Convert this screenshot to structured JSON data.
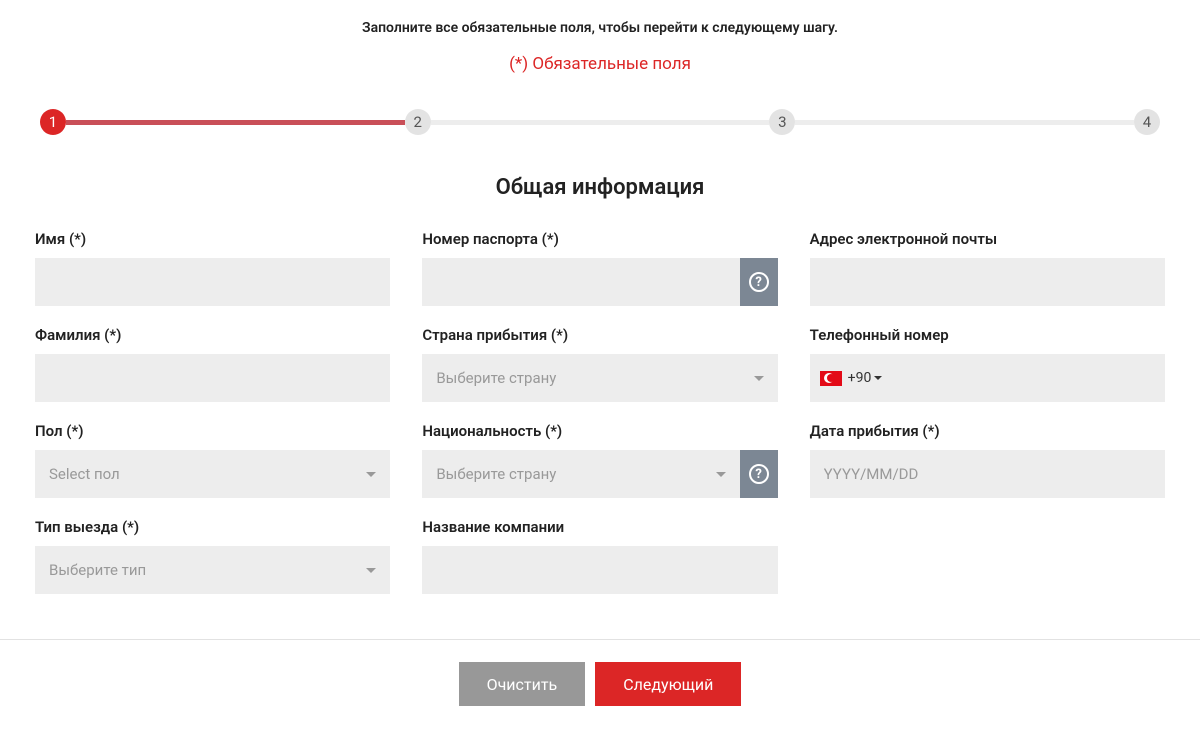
{
  "header": {
    "instruction": "Заполните все обязательные поля, чтобы перейти к следующему шагу.",
    "required_note": "(*) Обязательные поля"
  },
  "stepper": {
    "steps": [
      "1",
      "2",
      "3",
      "4"
    ],
    "active_index": 0
  },
  "section_title": "Общая информация",
  "fields": {
    "first_name": {
      "label": "Имя (*)",
      "value": ""
    },
    "passport": {
      "label": "Номер паспорта (*)",
      "value": ""
    },
    "email": {
      "label": "Адрес электронной почты",
      "value": ""
    },
    "last_name": {
      "label": "Фамилия (*)",
      "value": ""
    },
    "arrival_country": {
      "label": "Страна прибытия (*)",
      "placeholder": "Выберите страну"
    },
    "phone": {
      "label": "Телефонный номер",
      "country_code": "+90"
    },
    "gender": {
      "label": "Пол (*)",
      "placeholder": "Select пол"
    },
    "nationality": {
      "label": "Национальность (*)",
      "placeholder": "Выберите страну"
    },
    "arrival_date": {
      "label": "Дата прибытия (*)",
      "placeholder": "YYYY/MM/DD"
    },
    "exit_type": {
      "label": "Тип выезда (*)",
      "placeholder": "Выберите тип"
    },
    "company_name": {
      "label": "Название компании",
      "value": ""
    }
  },
  "footer": {
    "clear_label": "Очистить",
    "next_label": "Следующий"
  },
  "icons": {
    "help": "?"
  }
}
